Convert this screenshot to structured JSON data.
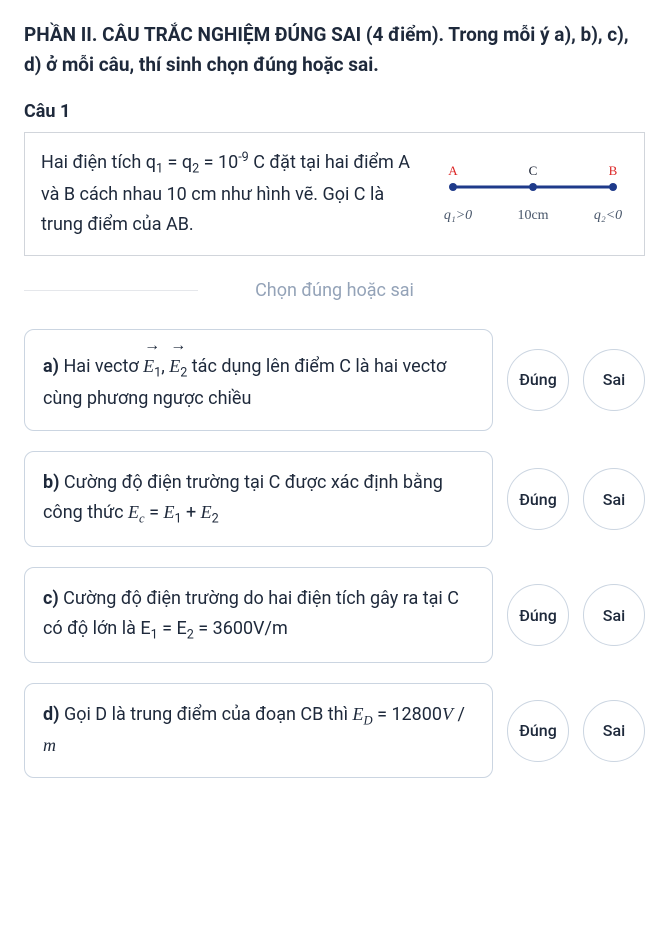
{
  "section": {
    "title": "PHẦN II. CÂU TRẮC NGHIỆM ĐÚNG SAI (4 điểm). Trong mỗi ý a), b), c), d) ở mỗi câu, thí sinh chọn đúng hoặc sai."
  },
  "question": {
    "label": "Câu 1",
    "text_p1": "Hai điện tích q",
    "text_p2": " = q",
    "text_p3": " = 10",
    "text_p4": " C đặt tại hai điểm A và B cách nhau 10 cm như hình vẽ. Gọi C là trung điểm của AB.",
    "sub1": "1",
    "sub2": "2",
    "sup_exp": "-9"
  },
  "diagram": {
    "A": "A",
    "B": "B",
    "C": "C",
    "q1": "q₁>0",
    "dist": "10cm",
    "q2": "q₂<0"
  },
  "choose_label": "Chọn đúng hoặc sai",
  "buttons": {
    "true": "Đúng",
    "false": "Sai"
  },
  "options": {
    "a": {
      "prefix": "a) ",
      "t1": "Hai vectơ ",
      "e1": "E",
      "s1": "1",
      "comma": ",",
      "e2": "E",
      "s2": "2",
      "t2": " tác dụng lên điểm C là hai vectơ cùng phương ngược chiều"
    },
    "b": {
      "prefix": "b) ",
      "t1": "Cường độ điện trường tại C được xác định bằng công thức ",
      "formula_ec": "E",
      "formula_c": "c",
      "formula_eq": " = ",
      "formula_e1": "E",
      "formula_1": "1",
      "formula_plus": " + ",
      "formula_e2": "E",
      "formula_2": "2"
    },
    "c": {
      "prefix": "c) ",
      "t1": "Cường độ điện trường do hai điện tích gây ra tại C có độ lớn là E",
      "s1": "1",
      "eq": " = E",
      "s2": "2",
      "t2": " = 3600V/m"
    },
    "d": {
      "prefix": "d) ",
      "t1": "Gọi D là trung điểm của đoạn CB thì ",
      "ed": "E",
      "sd": "D",
      "eq": " = ",
      "val": "12800",
      "unit_v": "V",
      "slash": " / ",
      "unit_m": "m"
    }
  }
}
